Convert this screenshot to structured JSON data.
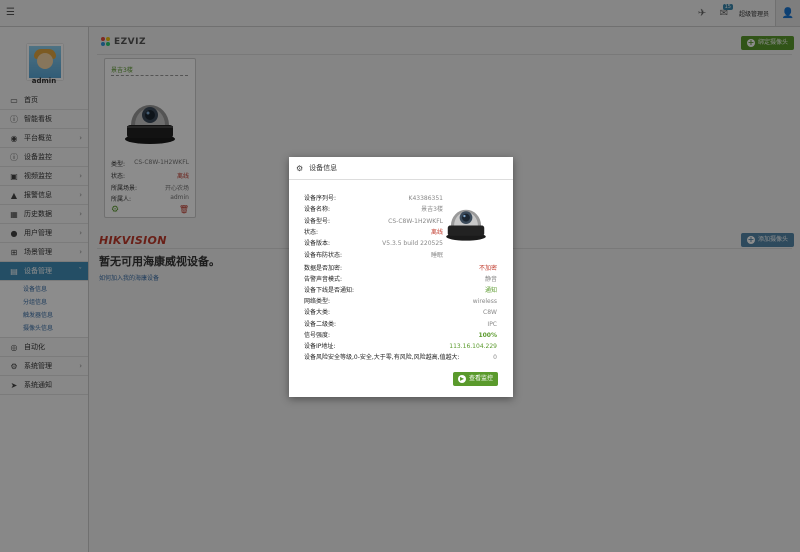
{
  "topbar": {
    "menu_icon": "hamburger-icon",
    "send_icon": "paper-plane-icon",
    "message_icon": "message-icon",
    "message_count": "15",
    "user_label": "超级管理员",
    "user_icon": "user-icon"
  },
  "sidebar": {
    "username": "admin",
    "items": [
      {
        "label": "首页",
        "icon": "desktop-icon"
      },
      {
        "label": "智能看板",
        "icon": "info-icon"
      },
      {
        "label": "平台概览",
        "icon": "eye-icon"
      },
      {
        "label": "设备监控",
        "icon": "info-icon"
      },
      {
        "label": "视频监控",
        "icon": "video-icon"
      },
      {
        "label": "报警信息",
        "icon": "warning-icon"
      },
      {
        "label": "历史数据",
        "icon": "calendar-icon"
      },
      {
        "label": "用户管理",
        "icon": "user-icon"
      },
      {
        "label": "场景管理",
        "icon": "grid-icon"
      },
      {
        "label": "设备管理",
        "icon": "hdd-icon"
      },
      {
        "label": "自动化",
        "icon": "circle-icon"
      },
      {
        "label": "系统管理",
        "icon": "gear-icon"
      },
      {
        "label": "系统通知",
        "icon": "send-icon"
      }
    ],
    "subitems": [
      "设备信息",
      "分组信息",
      "触发器信息",
      "摄像头信息"
    ]
  },
  "main": {
    "ezviz_brand": "EZVIZ",
    "bind_button": "绑定摄像头",
    "camera_card": {
      "name": "景吉3楼",
      "type_label": "类型:",
      "type_value": "CS-C8W-1H2WKFL",
      "status_label": "状态:",
      "status_value": "离线",
      "scene_label": "所属场景:",
      "scene_value": "开心农场",
      "owner_label": "所属人:",
      "owner_value": "admin"
    },
    "hik_brand": "HIKVISION",
    "add_button": "添加摄像头",
    "no_device": "暂无可用海康威视设备。",
    "join_link": "如何加入我的海康设备"
  },
  "modal": {
    "title": "设备信息",
    "rows1": [
      {
        "k": "设备序列号:",
        "v": "K43386351",
        "c": ""
      },
      {
        "k": "设备名称:",
        "v": "景吉3楼",
        "c": ""
      },
      {
        "k": "设备型号:",
        "v": "CS-C8W-1H2WKFL",
        "c": ""
      },
      {
        "k": "状态:",
        "v": "离线",
        "c": "red"
      },
      {
        "k": "设备版本:",
        "v": "V5.3.5 build 220525",
        "c": ""
      },
      {
        "k": "设备布防状态:",
        "v": "睡眠",
        "c": ""
      }
    ],
    "rows2": [
      {
        "k": "数据是否加密:",
        "v": "不加密",
        "c": "red"
      },
      {
        "k": "告警声音模式:",
        "v": "静音",
        "c": ""
      },
      {
        "k": "设备下线是否通知:",
        "v": "通知",
        "c": "green"
      },
      {
        "k": "网络类型:",
        "v": "wireless",
        "c": ""
      },
      {
        "k": "设备大类:",
        "v": "C8W",
        "c": ""
      },
      {
        "k": "设备二级类:",
        "v": "IPC",
        "c": ""
      },
      {
        "k": "信号强度:",
        "v": "100%",
        "c": "green bold"
      },
      {
        "k": "设备IP地址:",
        "v": "113.16.104.229",
        "c": "green"
      },
      {
        "k": "设备风险安全等级,0-安全,大于零,有风险,风险越高,值越大:",
        "v": "0",
        "c": ""
      }
    ],
    "view_button": "查看监控"
  },
  "colors": {
    "accent_green": "#5a9a2c",
    "accent_blue": "#438eb9",
    "alert_red": "#c0392b"
  }
}
